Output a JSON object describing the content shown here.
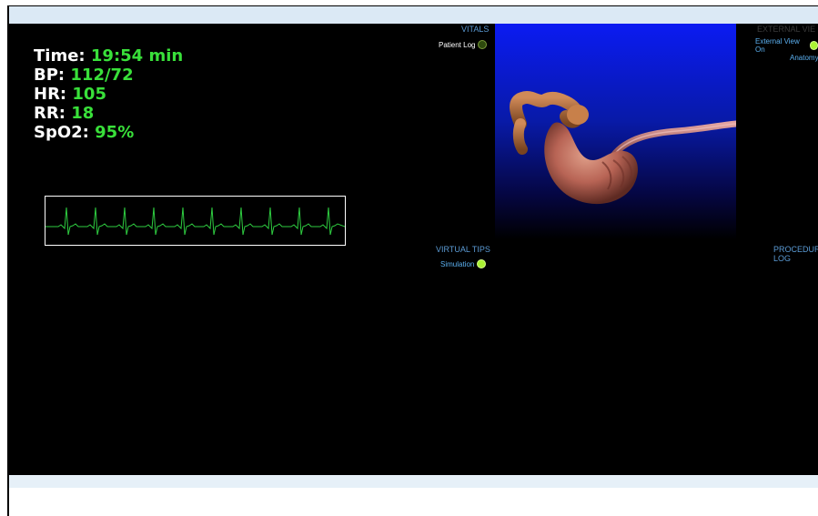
{
  "vitals": {
    "time_label": "Time:",
    "time_value": "19:54 min",
    "bp_label": "BP:",
    "bp_value": "112/72",
    "hr_label": "HR:",
    "hr_value": "105",
    "rr_label": "RR:",
    "rr_value": "18",
    "spo2_label": "SpO2:",
    "spo2_value": "95%"
  },
  "panels": {
    "vitals_title": "VITALS",
    "patient_log_label": "Patient Log",
    "external_view_title": "EXTERNAL VIE",
    "external_view_toggle": "External View On",
    "anatomy_label": "Anatomy",
    "virtual_tips_title": "VIRTUAL TIPS",
    "simulation_label": "Simulation",
    "procedure_title": "PROCEDUR",
    "procedure_title2": "LOG"
  },
  "colors": {
    "vital_value": "#39e03a",
    "panel_title": "#5b9bd5",
    "ecg_trace": "#2ecc40"
  }
}
